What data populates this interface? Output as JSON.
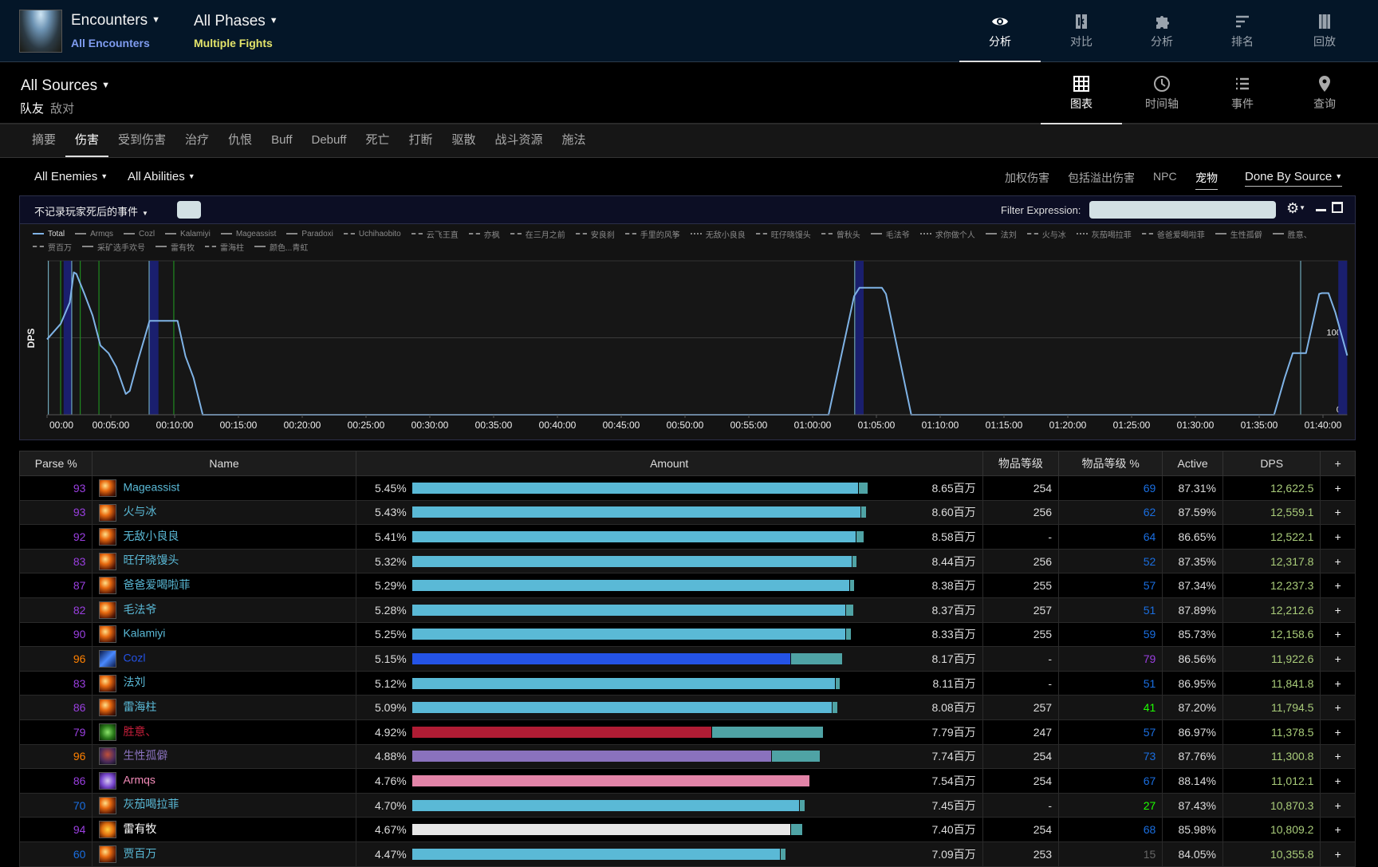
{
  "header": {
    "encounters_label": "Encounters",
    "encounters_sub": "All Encounters",
    "phases_label": "All Phases",
    "phases_sub": "Multiple Fights",
    "nav": [
      {
        "label": "分析",
        "icon": "eye-icon",
        "active": true
      },
      {
        "label": "对比",
        "icon": "compare-icon",
        "active": false
      },
      {
        "label": "分析",
        "icon": "puzzle-icon",
        "active": false
      },
      {
        "label": "排名",
        "icon": "sort-icon",
        "active": false
      },
      {
        "label": "回放",
        "icon": "film-icon",
        "active": false
      }
    ]
  },
  "sources": {
    "label": "All Sources",
    "friendly": "队友",
    "hostile": "敌对",
    "views": [
      {
        "label": "图表",
        "icon": "grid-icon",
        "active": true
      },
      {
        "label": "时间轴",
        "icon": "clock-icon",
        "active": false
      },
      {
        "label": "事件",
        "icon": "list-icon",
        "active": false
      },
      {
        "label": "查询",
        "icon": "map-pin-icon",
        "active": false
      }
    ]
  },
  "tabs": [
    {
      "label": "摘要",
      "active": false
    },
    {
      "label": "伤害",
      "active": true
    },
    {
      "label": "受到伤害",
      "active": false
    },
    {
      "label": "治疗",
      "active": false
    },
    {
      "label": "仇恨",
      "active": false
    },
    {
      "label": "Buff",
      "active": false
    },
    {
      "label": "Debuff",
      "active": false
    },
    {
      "label": "死亡",
      "active": false
    },
    {
      "label": "打断",
      "active": false
    },
    {
      "label": "驱散",
      "active": false
    },
    {
      "label": "战斗资源",
      "active": false
    },
    {
      "label": "施法",
      "active": false
    }
  ],
  "filters": {
    "enemies": "All Enemies",
    "abilities": "All Abilities",
    "options": [
      {
        "label": "加权伤害",
        "on": false
      },
      {
        "label": "包括溢出伤害",
        "on": false
      },
      {
        "label": "NPC",
        "on": false
      },
      {
        "label": "宠物",
        "on": true
      }
    ],
    "done_by": "Done By Source"
  },
  "panel": {
    "death_filter": "不记录玩家死后的事件",
    "filter_label": "Filter Expression:",
    "filter_value": ""
  },
  "colors": {
    "mage": "#5ab9d6",
    "pet": "#4fa3a5",
    "shaman": "#2453e6",
    "deathknight": "#b01c34",
    "demonhunter": "#8a72bd",
    "paladin": "#e284a8",
    "priest": "#e6e6e6",
    "dps_text": "#a9cc7a",
    "total_line": "#7fb3e6"
  },
  "chart_data": {
    "type": "line",
    "ylabel": "DPS",
    "ylim": [
      0,
      200000
    ],
    "xlim": [
      "00:00:00",
      "01:41:54"
    ],
    "y_ticks": [
      {
        "value": 0,
        "label": "0k"
      },
      {
        "value": 100000,
        "label": "100k"
      }
    ],
    "x_ticks": [
      "00:00",
      "00:05:00",
      "00:10:00",
      "00:15:00",
      "00:20:00",
      "00:25:00",
      "00:30:00",
      "00:35:00",
      "00:40:00",
      "00:45:00",
      "00:50:00",
      "00:55:00",
      "01:00:00",
      "01:05:00",
      "01:10:00",
      "01:15:00",
      "01:20:00",
      "01:25:00",
      "01:30:00",
      "01:35:00",
      "01:40:00"
    ],
    "grid": true,
    "legend": [
      {
        "name": "Total",
        "dash": "solid"
      },
      {
        "name": "Armqs",
        "dash": "solid"
      },
      {
        "name": "Cozl",
        "dash": "solid"
      },
      {
        "name": "Kalamiyi",
        "dash": "solid"
      },
      {
        "name": "Mageassist",
        "dash": "solid"
      },
      {
        "name": "Paradoxi",
        "dash": "solid"
      },
      {
        "name": "Uchihaobito",
        "dash": "dashed"
      },
      {
        "name": "云飞王直",
        "dash": "dashed"
      },
      {
        "name": "亦枫",
        "dash": "dashdot"
      },
      {
        "name": "在三月之前",
        "dash": "dashed"
      },
      {
        "name": "安良刹",
        "dash": "dashed"
      },
      {
        "name": "手里的风筝",
        "dash": "dashdot"
      },
      {
        "name": "无敌小良良",
        "dash": "dotted"
      },
      {
        "name": "旺仔晓馒头",
        "dash": "dashdot"
      },
      {
        "name": "曾秋头",
        "dash": "dashdot"
      },
      {
        "name": "毛法爷",
        "dash": "solid"
      },
      {
        "name": "求你做个人",
        "dash": "dotted"
      },
      {
        "name": "法刘",
        "dash": "solid"
      },
      {
        "name": "火与冰",
        "dash": "dashed"
      },
      {
        "name": "灰茄喝拉菲",
        "dash": "dotted"
      },
      {
        "name": "爸爸爱喝啦菲",
        "dash": "dashdot"
      },
      {
        "name": "生性孤僻",
        "dash": "solid"
      },
      {
        "name": "胜意、",
        "dash": "solid"
      },
      {
        "name": "贾百万",
        "dash": "dashdot"
      },
      {
        "name": "采矿选手欢号",
        "dash": "solid"
      },
      {
        "name": "雷有牧",
        "dash": "solid"
      },
      {
        "name": "雷海柱",
        "dash": "dashed"
      },
      {
        "name": "颜色...青虹",
        "dash": "solid"
      }
    ],
    "series": [
      {
        "name": "Total",
        "points": [
          [
            "00:00:00",
            98000
          ],
          [
            "00:01:04",
            118000
          ],
          [
            "00:01:47",
            146000
          ],
          [
            "00:02:06",
            185000
          ],
          [
            "00:02:18",
            183000
          ],
          [
            "00:02:56",
            157000
          ],
          [
            "00:03:34",
            129000
          ],
          [
            "00:04:11",
            90000
          ],
          [
            "00:04:49",
            80000
          ],
          [
            "00:05:26",
            62000
          ],
          [
            "00:06:10",
            27000
          ],
          [
            "00:06:29",
            31000
          ],
          [
            "00:07:06",
            69000
          ],
          [
            "00:08:02",
            122000
          ],
          [
            "00:10:14",
            122000
          ],
          [
            "00:10:51",
            76000
          ],
          [
            "00:11:29",
            48000
          ],
          [
            "00:12:12",
            0
          ],
          [
            "01:01:15",
            0
          ],
          [
            "01:03:15",
            154000
          ],
          [
            "01:03:40",
            165000
          ],
          [
            "01:05:26",
            165000
          ],
          [
            "01:05:45",
            157000
          ],
          [
            "01:07:44",
            0
          ],
          [
            "01:36:10",
            0
          ],
          [
            "01:37:00",
            48000
          ],
          [
            "01:37:38",
            80000
          ],
          [
            "01:38:40",
            80000
          ],
          [
            "01:39:42",
            157000
          ],
          [
            "01:39:55",
            158000
          ],
          [
            "01:40:26",
            158000
          ],
          [
            "01:40:58",
            133000
          ],
          [
            "01:41:54",
            77000
          ]
        ]
      }
    ],
    "markers": {
      "lines": [
        {
          "t": "00:00:06",
          "color": "#6fa7b8"
        },
        {
          "t": "00:01:04",
          "color": "#1f8a1f"
        },
        {
          "t": "00:01:56",
          "color": "#6fa7b8"
        },
        {
          "t": "00:02:36",
          "color": "#1f8a1f"
        },
        {
          "t": "00:04:04",
          "color": "#1f8a1f"
        },
        {
          "t": "00:08:00",
          "color": "#6fa7b8"
        },
        {
          "t": "00:09:56",
          "color": "#1f8a1f"
        },
        {
          "t": "01:03:18",
          "color": "#6fa7b8"
        },
        {
          "t": "01:38:15",
          "color": "#6fa7b8"
        }
      ],
      "bands": [
        {
          "from": "00:01:18",
          "to": "00:01:56"
        },
        {
          "from": "00:08:00",
          "to": "00:08:44"
        },
        {
          "from": "01:03:21",
          "to": "01:04:00"
        },
        {
          "from": "01:41:12",
          "to": "01:41:54"
        }
      ]
    }
  },
  "table": {
    "headers": [
      "Parse %",
      "Name",
      "Amount",
      "物品等级",
      "物品等级 %",
      "Active",
      "DPS",
      "+"
    ],
    "rows": [
      {
        "parse": "93",
        "parse_color": "#9a3fe0",
        "name": "Mageassist",
        "cls": "mage",
        "pct": "5.45%",
        "pct_value": 5.45,
        "main_share": 0.979,
        "amount": "8.65百万",
        "ilvl": "254",
        "ilvl_pct": "69",
        "ilvl_color": "#1a6ee0",
        "active": "87.31%",
        "dps": "12,622.5"
      },
      {
        "parse": "93",
        "parse_color": "#9a3fe0",
        "name": "火与冰",
        "cls": "mage",
        "pct": "5.43%",
        "pct_value": 5.43,
        "main_share": 0.988,
        "amount": "8.60百万",
        "ilvl": "256",
        "ilvl_pct": "62",
        "ilvl_color": "#1a6ee0",
        "active": "87.59%",
        "dps": "12,559.1"
      },
      {
        "parse": "92",
        "parse_color": "#9a3fe0",
        "name": "无敌小良良",
        "cls": "mage",
        "pct": "5.41%",
        "pct_value": 5.41,
        "main_share": 0.982,
        "amount": "8.58百万",
        "ilvl": "-",
        "ilvl_pct": "64",
        "ilvl_color": "#1a6ee0",
        "active": "86.65%",
        "dps": "12,522.1"
      },
      {
        "parse": "83",
        "parse_color": "#9a3fe0",
        "name": "旺仔晓馒头",
        "cls": "mage",
        "pct": "5.32%",
        "pct_value": 5.32,
        "main_share": 0.989,
        "amount": "8.44百万",
        "ilvl": "256",
        "ilvl_pct": "52",
        "ilvl_color": "#1a6ee0",
        "active": "87.35%",
        "dps": "12,317.8"
      },
      {
        "parse": "87",
        "parse_color": "#9a3fe0",
        "name": "爸爸爱喝啦菲",
        "cls": "mage",
        "pct": "5.29%",
        "pct_value": 5.29,
        "main_share": 0.989,
        "amount": "8.38百万",
        "ilvl": "255",
        "ilvl_pct": "57",
        "ilvl_color": "#1a6ee0",
        "active": "87.34%",
        "dps": "12,237.3"
      },
      {
        "parse": "82",
        "parse_color": "#9a3fe0",
        "name": "毛法爷",
        "cls": "mage",
        "pct": "5.28%",
        "pct_value": 5.28,
        "main_share": 0.982,
        "amount": "8.37百万",
        "ilvl": "257",
        "ilvl_pct": "51",
        "ilvl_color": "#1a6ee0",
        "active": "87.89%",
        "dps": "12,212.6"
      },
      {
        "parse": "90",
        "parse_color": "#9a3fe0",
        "name": "Kalamiyi",
        "cls": "mage",
        "pct": "5.25%",
        "pct_value": 5.25,
        "main_share": 0.987,
        "amount": "8.33百万",
        "ilvl": "255",
        "ilvl_pct": "59",
        "ilvl_color": "#1a6ee0",
        "active": "85.73%",
        "dps": "12,158.6"
      },
      {
        "parse": "96",
        "parse_color": "#ff8000",
        "name": "Cozl",
        "cls": "shaman",
        "pct": "5.15%",
        "pct_value": 5.15,
        "main_share": 0.879,
        "amount": "8.17百万",
        "ilvl": "-",
        "ilvl_pct": "79",
        "ilvl_color": "#9a3fe0",
        "active": "86.56%",
        "dps": "11,922.6"
      },
      {
        "parse": "83",
        "parse_color": "#9a3fe0",
        "name": "法刘",
        "cls": "mage",
        "pct": "5.12%",
        "pct_value": 5.12,
        "main_share": 0.989,
        "amount": "8.11百万",
        "ilvl": "-",
        "ilvl_pct": "51",
        "ilvl_color": "#1a6ee0",
        "active": "86.95%",
        "dps": "11,841.8"
      },
      {
        "parse": "86",
        "parse_color": "#9a3fe0",
        "name": "雷海柱",
        "cls": "mage",
        "pct": "5.09%",
        "pct_value": 5.09,
        "main_share": 0.987,
        "amount": "8.08百万",
        "ilvl": "257",
        "ilvl_pct": "41",
        "ilvl_color": "#1eff00",
        "active": "87.20%",
        "dps": "11,794.5"
      },
      {
        "parse": "79",
        "parse_color": "#9a3fe0",
        "name": "胜意、",
        "cls": "deathknight",
        "pct": "4.92%",
        "pct_value": 4.92,
        "main_share": 0.728,
        "amount": "7.79百万",
        "ilvl": "247",
        "ilvl_pct": "57",
        "ilvl_color": "#1a6ee0",
        "active": "86.97%",
        "dps": "11,378.5"
      },
      {
        "parse": "96",
        "parse_color": "#ff8000",
        "name": "生性孤僻",
        "cls": "demonhunter",
        "pct": "4.88%",
        "pct_value": 4.88,
        "main_share": 0.881,
        "amount": "7.74百万",
        "ilvl": "254",
        "ilvl_pct": "73",
        "ilvl_color": "#1a6ee0",
        "active": "87.76%",
        "dps": "11,300.8"
      },
      {
        "parse": "86",
        "parse_color": "#9a3fe0",
        "name": "Armqs",
        "cls": "paladin",
        "pct": "4.76%",
        "pct_value": 4.76,
        "main_share": 1.0,
        "amount": "7.54百万",
        "ilvl": "254",
        "ilvl_pct": "67",
        "ilvl_color": "#1a6ee0",
        "active": "88.14%",
        "dps": "11,012.1"
      },
      {
        "parse": "70",
        "parse_color": "#1a6ee0",
        "name": "灰茄喝拉菲",
        "cls": "mage",
        "pct": "4.70%",
        "pct_value": 4.7,
        "main_share": 0.986,
        "amount": "7.45百万",
        "ilvl": "-",
        "ilvl_pct": "27",
        "ilvl_color": "#1eff00",
        "active": "87.43%",
        "dps": "10,870.3"
      },
      {
        "parse": "94",
        "parse_color": "#9a3fe0",
        "name": "雷有牧",
        "cls": "priest",
        "pct": "4.67%",
        "pct_value": 4.67,
        "main_share": 0.969,
        "amount": "7.40百万",
        "ilvl": "254",
        "ilvl_pct": "68",
        "ilvl_color": "#1a6ee0",
        "active": "85.98%",
        "dps": "10,809.2"
      },
      {
        "parse": "60",
        "parse_color": "#1a6ee0",
        "name": "贾百万",
        "cls": "mage",
        "pct": "4.47%",
        "pct_value": 4.47,
        "main_share": 0.985,
        "amount": "7.09百万",
        "ilvl": "253",
        "ilvl_pct": "15",
        "ilvl_color": "#666666",
        "active": "84.05%",
        "dps": "10,355.8"
      }
    ]
  }
}
